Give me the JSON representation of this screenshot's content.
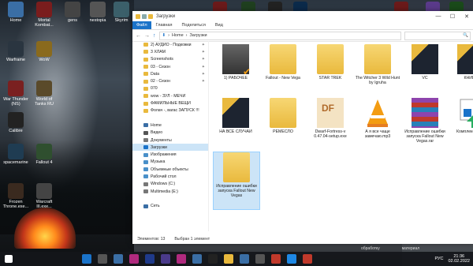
{
  "desktop": {
    "icons": [
      {
        "label": "Home",
        "color": "#3a6ea5"
      },
      {
        "label": "Mortal Kombat...",
        "color": "#7a1d1d"
      },
      {
        "label": "gens",
        "color": "#444"
      },
      {
        "label": "nestopia",
        "color": "#555"
      },
      {
        "label": "Skyrim",
        "color": "#3b5f6a"
      },
      {
        "label": "Warframe",
        "color": "#2a3540"
      },
      {
        "label": "WoW",
        "color": "#8a6a1d"
      },
      {
        "label": "War Thunder (NS)",
        "color": "#7a2020"
      },
      {
        "label": "World of Tanks RU",
        "color": "#5a4a2a"
      },
      {
        "label": "Calibre",
        "color": "#222"
      },
      {
        "label": "spacemarine",
        "color": "#1f3c52"
      },
      {
        "label": "Fallout 4",
        "color": "#2f4f2f"
      },
      {
        "label": "Frozen Throne.exe...",
        "color": "#3a2a1f"
      },
      {
        "label": "Warcraft III.exe...",
        "color": "#444"
      }
    ],
    "bottom_labels": [
      "обработку",
      "материал"
    ]
  },
  "window": {
    "title": "Загрузки",
    "controls": {
      "min": "—",
      "max": "☐",
      "close": "✕"
    },
    "ribbon": {
      "file": "Файл",
      "tabs": [
        "Главная",
        "Поделиться",
        "Вид"
      ]
    },
    "address": {
      "path": [
        "Home",
        "Загрузки"
      ],
      "chev": "›",
      "search_placeholder": "🔍"
    },
    "nav": {
      "back": "←",
      "fwd": "→",
      "up": "↑"
    },
    "sidebar": [
      {
        "label": "2) АУДИО - Подкожки",
        "pin": true,
        "color": "#e9b93d"
      },
      {
        "label": "3 ХЛАМ",
        "pin": true,
        "color": "#e9b93d"
      },
      {
        "label": "Screenshots",
        "pin": true,
        "color": "#e9b93d"
      },
      {
        "label": "03 - Сезон",
        "pin": true,
        "color": "#e9b93d"
      },
      {
        "label": "Data",
        "pin": true,
        "color": "#e9b93d"
      },
      {
        "label": "02 - Сезон",
        "pin": true,
        "color": "#e9b93d"
      },
      {
        "label": "070",
        "pin": false,
        "color": "#e9b93d"
      },
      {
        "label": "wow - ЗУЛ - МЕЧИ",
        "pin": false,
        "color": "#e9b93d"
      },
      {
        "label": "ФАМИЛЬНЫЕ ВЕЩИ",
        "pin": false,
        "color": "#e9b93d"
      },
      {
        "label": "Фолач -, вагас ЗАПУСК !!!",
        "pin": false,
        "color": "#e9b93d"
      },
      {
        "label": "",
        "pin": false,
        "color": "transparent"
      },
      {
        "label": "Home",
        "pin": false,
        "color": "#3a6ea5"
      },
      {
        "label": "Видео",
        "pin": false,
        "color": "#555"
      },
      {
        "label": "Документы",
        "pin": false,
        "color": "#777"
      },
      {
        "label": "Загрузки",
        "pin": false,
        "color": "#1a73c9",
        "selected": true
      },
      {
        "label": "Изображения",
        "pin": false,
        "color": "#4a90c9"
      },
      {
        "label": "Музыка",
        "pin": false,
        "color": "#4a90c9"
      },
      {
        "label": "Объемные объекты",
        "pin": false,
        "color": "#4a90c9"
      },
      {
        "label": "Рабочий стол",
        "pin": false,
        "color": "#4a90c9"
      },
      {
        "label": "Windows (C:)",
        "pin": false,
        "color": "#777"
      },
      {
        "label": "Multimedia (E:)",
        "pin": false,
        "color": "#777"
      },
      {
        "label": "",
        "pin": false,
        "color": "transparent"
      },
      {
        "label": "Сеть",
        "pin": false,
        "color": "#3a6ea5"
      }
    ],
    "files": [
      {
        "label": "1) РАБОЧЕЕ",
        "kind": "pc"
      },
      {
        "label": "Fallout - New Vega",
        "kind": "folder"
      },
      {
        "label": "STAR TREK",
        "kind": "folder"
      },
      {
        "label": "The Witcher 3 Wild Hunt by Igruha",
        "kind": "folder"
      },
      {
        "label": "VC",
        "kind": "dark"
      },
      {
        "label": "КНИГИ",
        "kind": "dark"
      },
      {
        "label": "НА ВСЕ СЛУЧАИ",
        "kind": "dark"
      },
      {
        "label": "РЕМЕСЛО",
        "kind": "folder"
      },
      {
        "label": "Dwarf-Fortress-v 0.47.04-setup.exe",
        "kind": "df"
      },
      {
        "label": "А я все чаще замечаю.mp3",
        "kind": "vlc"
      },
      {
        "label": "Исправление ошибки запуска Fallout New Vegas.rar",
        "kind": "rar"
      },
      {
        "label": "Комплекс DOC",
        "kind": "doc"
      },
      {
        "label": "Исправление ошибки запуска Fallout New Vegas",
        "kind": "folder",
        "selected": true
      }
    ],
    "status": {
      "count": "Элементов: 13",
      "selected": "Выбран 1 элемент"
    }
  },
  "taskbar": {
    "icons": [
      "#1a73c9",
      "#555",
      "#3a6ea5",
      "#b02a7e",
      "#1f3a8a",
      "#4a3a8a",
      "#b02a7e",
      "#3a6ea5",
      "#222",
      "#e9b93d",
      "#3a6ea5",
      "#555",
      "#c0392b",
      "#1e88e5",
      "#c0392b"
    ],
    "lang": "РУС",
    "time": "21:36",
    "date": "02.02.2022"
  }
}
